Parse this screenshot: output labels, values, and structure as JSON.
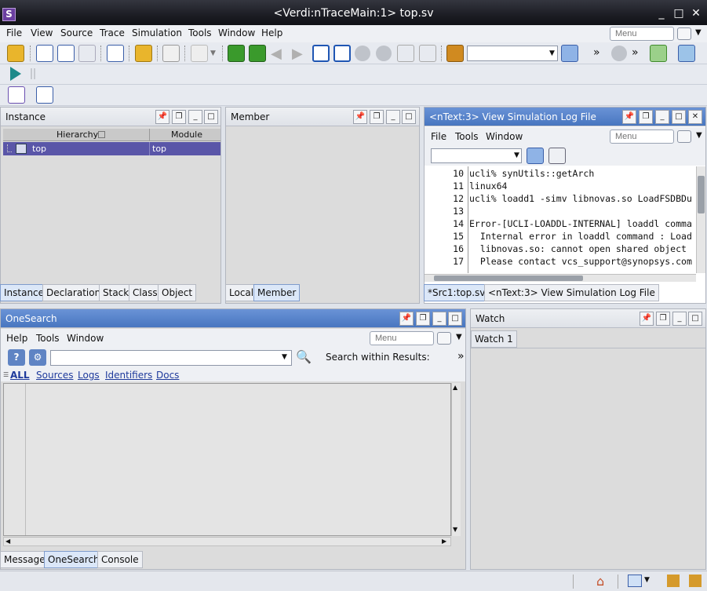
{
  "window": {
    "title": "<Verdi:nTraceMain:1> top.sv",
    "min": "_",
    "max": "□",
    "close": "✕"
  },
  "menu": {
    "file": "File",
    "view": "View",
    "source": "Source",
    "trace": "Trace",
    "simulation": "Simulation",
    "tools": "Tools",
    "window": "Window",
    "help": "Help",
    "search_placeholder": "Menu"
  },
  "instance_panel": {
    "title": "Instance",
    "columns": [
      "Hierarchy",
      "Module"
    ],
    "rows": [
      {
        "hierarchy": "top",
        "module": "top"
      }
    ],
    "tabs": [
      "Instance",
      "Declaration",
      "Stack",
      "Class",
      "Object"
    ]
  },
  "member_panel": {
    "title": "Member",
    "tabs": [
      "Local",
      "Member"
    ]
  },
  "log_panel": {
    "title": "<nText:3> View Simulation Log File",
    "menu": {
      "file": "File",
      "tools": "Tools",
      "window": "Window",
      "search_placeholder": "Menu"
    },
    "lines": [
      {
        "n": "10",
        "text": "ucli% synUtils::getArch"
      },
      {
        "n": "11",
        "text": "linux64"
      },
      {
        "n": "12",
        "text": "ucli% loadd1 -simv libnovas.so LoadFSDBDu"
      },
      {
        "n": "13",
        "text": ""
      },
      {
        "n": "14",
        "text": "Error-[UCLI-LOADDL-INTERNAL] loaddl comma"
      },
      {
        "n": "15",
        "text": "  Internal error in loaddl command : Load"
      },
      {
        "n": "16",
        "text": "  libnovas.so: cannot open shared object"
      },
      {
        "n": "17",
        "text": "  Please contact vcs_support@synopsys.com"
      }
    ],
    "tabs": [
      "*Src1:top.sv",
      "<nText:3> View Simulation Log File"
    ]
  },
  "onesearch_panel": {
    "title": "OneSearch",
    "menu": {
      "help": "Help",
      "tools": "Tools",
      "window": "Window",
      "search_placeholder": "Menu"
    },
    "search_within": "Search within Results:",
    "more": "»",
    "filters": [
      "ALL",
      "Sources",
      "Logs",
      "Identifiers",
      "Docs"
    ],
    "tabs": [
      "Message",
      "OneSearch",
      "Console"
    ]
  },
  "watch_panel": {
    "title": "Watch",
    "tabs": [
      "Watch 1"
    ]
  }
}
